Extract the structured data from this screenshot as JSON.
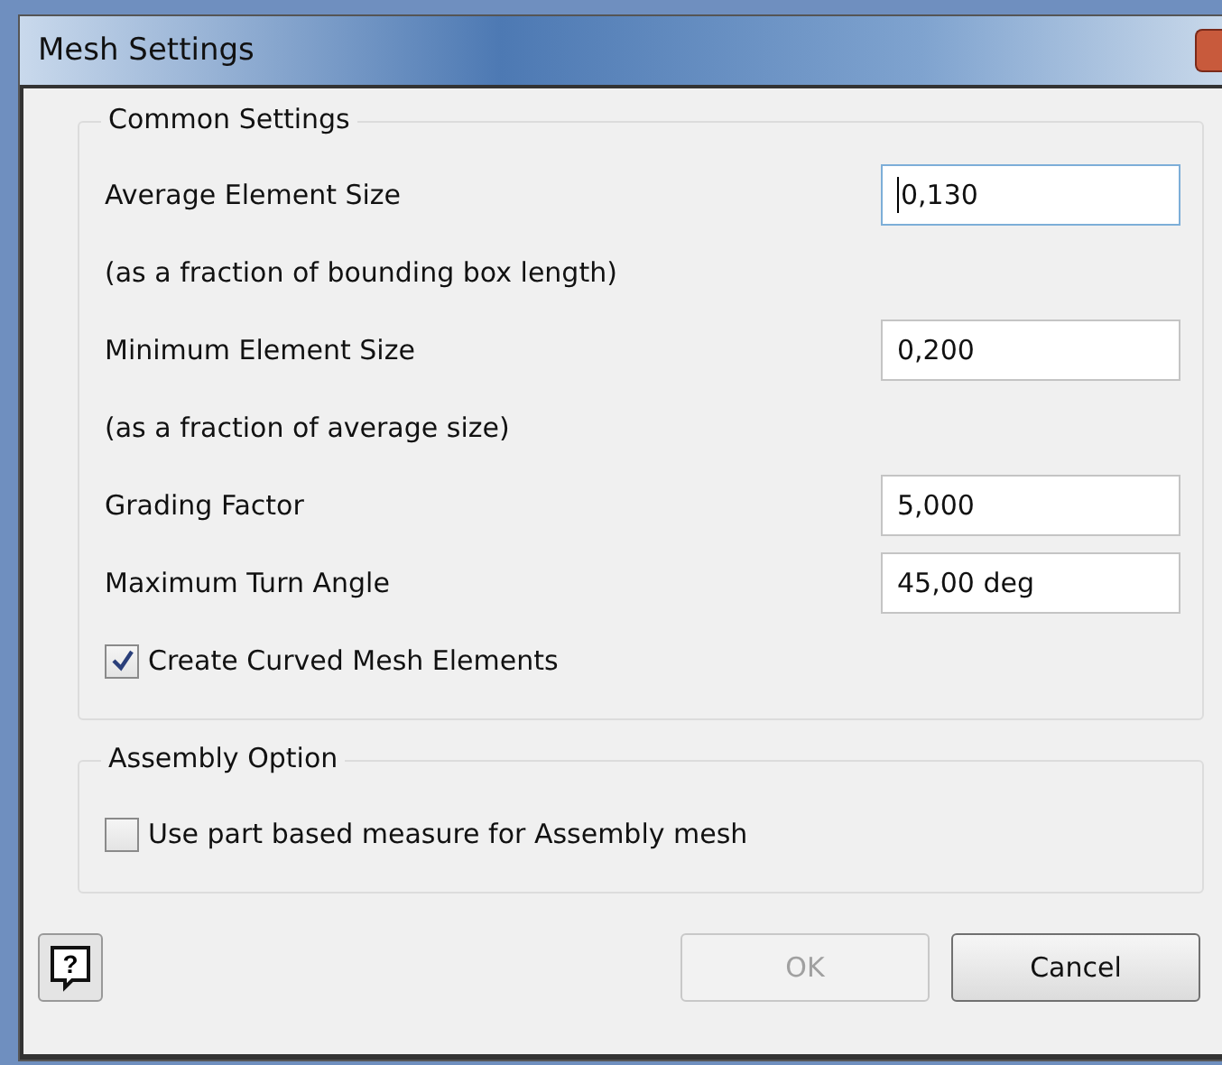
{
  "window": {
    "title": "Mesh Settings"
  },
  "common_settings": {
    "title": "Common Settings",
    "rows": [
      {
        "kind": "field",
        "label": "Average Element Size",
        "value": "0,130",
        "focused": true
      },
      {
        "kind": "note",
        "label": "(as a fraction of bounding box length)"
      },
      {
        "kind": "field",
        "label": "Minimum Element Size",
        "value": "0,200",
        "focused": false
      },
      {
        "kind": "note",
        "label": "(as a fraction of average size)"
      },
      {
        "kind": "field",
        "label": "Grading Factor",
        "value": "5,000",
        "focused": false
      },
      {
        "kind": "field",
        "label": "Maximum Turn Angle",
        "value": "45,00 deg",
        "focused": false
      },
      {
        "kind": "checkbox",
        "label": "Create Curved Mesh Elements",
        "checked": true
      }
    ]
  },
  "assembly_option": {
    "title": "Assembly Option",
    "rows": [
      {
        "kind": "checkbox",
        "label": "Use part based measure for Assembly mesh",
        "checked": false
      }
    ]
  },
  "help_button": {
    "label": "?"
  },
  "buttons": [
    {
      "label": "OK",
      "disabled": true
    },
    {
      "label": "Cancel",
      "disabled": false
    }
  ]
}
